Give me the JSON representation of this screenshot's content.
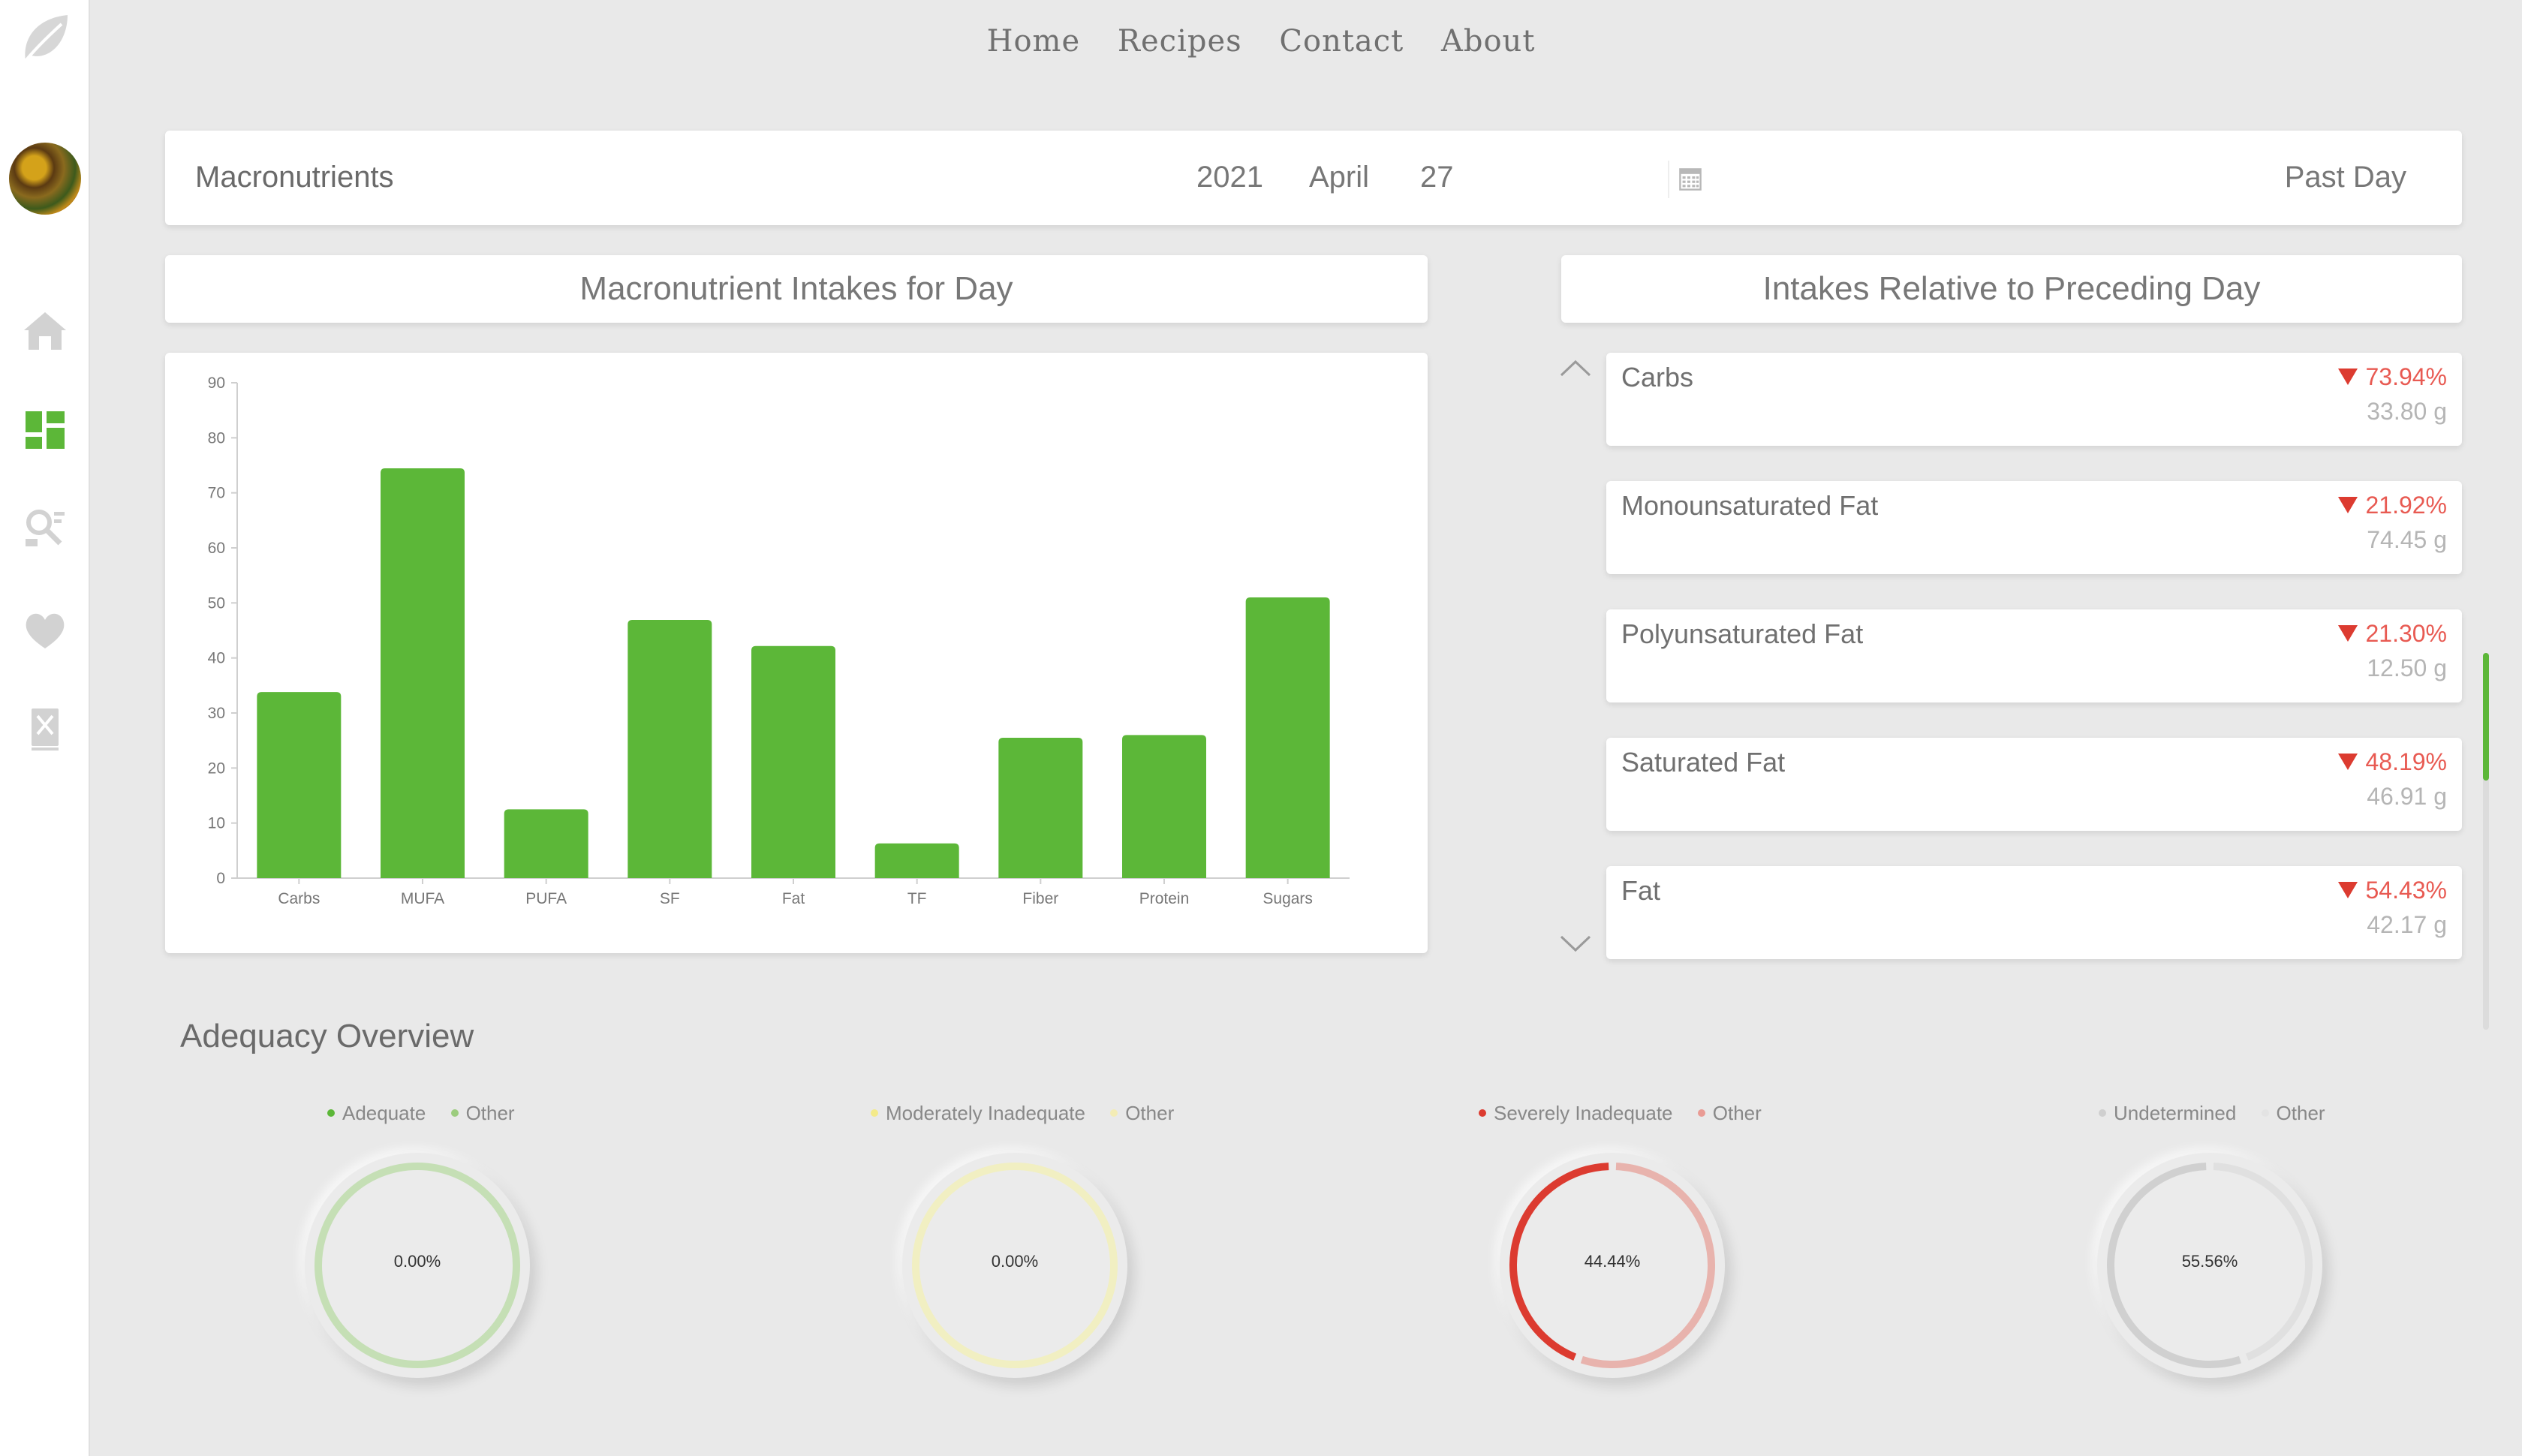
{
  "nav": {
    "items": [
      "Home",
      "Recipes",
      "Contact",
      "About"
    ]
  },
  "header": {
    "title": "Macronutrients",
    "year": "2021",
    "month": "April",
    "day": "27",
    "range": "Past Day"
  },
  "chart_section": {
    "title": "Macronutrient Intakes for Day"
  },
  "relative_section": {
    "title": "Intakes Relative to Preceding Day"
  },
  "chart_data": {
    "type": "bar",
    "categories": [
      "Carbs",
      "MUFA",
      "PUFA",
      "SF",
      "Fat",
      "TF",
      "Fiber",
      "Protein",
      "Sugars"
    ],
    "values": [
      33.8,
      74.45,
      12.5,
      46.91,
      42.17,
      6.3,
      25.5,
      26.0,
      51.0
    ],
    "ylim": [
      0,
      90
    ],
    "yticks": [
      0,
      10,
      20,
      30,
      40,
      50,
      60,
      70,
      80,
      90
    ],
    "grid": false,
    "bar_color": "#5cb738"
  },
  "relative_items": [
    {
      "name": "Carbs",
      "pct": "73.94%",
      "grams": "33.80 g"
    },
    {
      "name": "Monounsaturated Fat",
      "pct": "21.92%",
      "grams": "74.45 g"
    },
    {
      "name": "Polyunsaturated Fat",
      "pct": "21.30%",
      "grams": "12.50 g"
    },
    {
      "name": "Saturated Fat",
      "pct": "48.19%",
      "grams": "46.91 g"
    },
    {
      "name": "Fat",
      "pct": "54.43%",
      "grams": "42.17 g"
    }
  ],
  "adequacy": {
    "title": "Adequacy Overview",
    "donuts": [
      {
        "label": "Adequate",
        "other": "Other",
        "value": "0.00%",
        "fraction": 0.0,
        "color": "#5cb738",
        "other_color": "#c5dfb5",
        "legend_color": "#5cb738",
        "other_legend_color": "#9ccc7e"
      },
      {
        "label": "Moderately Inadequate",
        "other": "Other",
        "value": "0.00%",
        "fraction": 0.0,
        "color": "#f0e36a",
        "other_color": "#f1efc2",
        "legend_color": "#f3ea8a",
        "other_legend_color": "#f3ecb5"
      },
      {
        "label": "Severely Inadequate",
        "other": "Other",
        "value": "44.44%",
        "fraction": 0.4444,
        "color": "#dc3b30",
        "other_color": "#e8b3ad",
        "legend_color": "#dc3b30",
        "other_legend_color": "#e99b94"
      },
      {
        "label": "Undetermined",
        "other": "Other",
        "value": "55.56%",
        "fraction": 0.5556,
        "color": "#d0d0d0",
        "other_color": "#e0e0e0",
        "legend_color": "#cfcfcf",
        "other_legend_color": "#e3e3e3"
      }
    ]
  },
  "colors": {
    "accent": "#5cb738",
    "negative": "#dc3b30",
    "background": "#e9e9e9"
  },
  "icons": {
    "logo": "leaf-icon",
    "nav": [
      "home-icon",
      "dashboard-icon",
      "nutrient-search-icon",
      "heart-icon",
      "recipe-icon"
    ]
  }
}
